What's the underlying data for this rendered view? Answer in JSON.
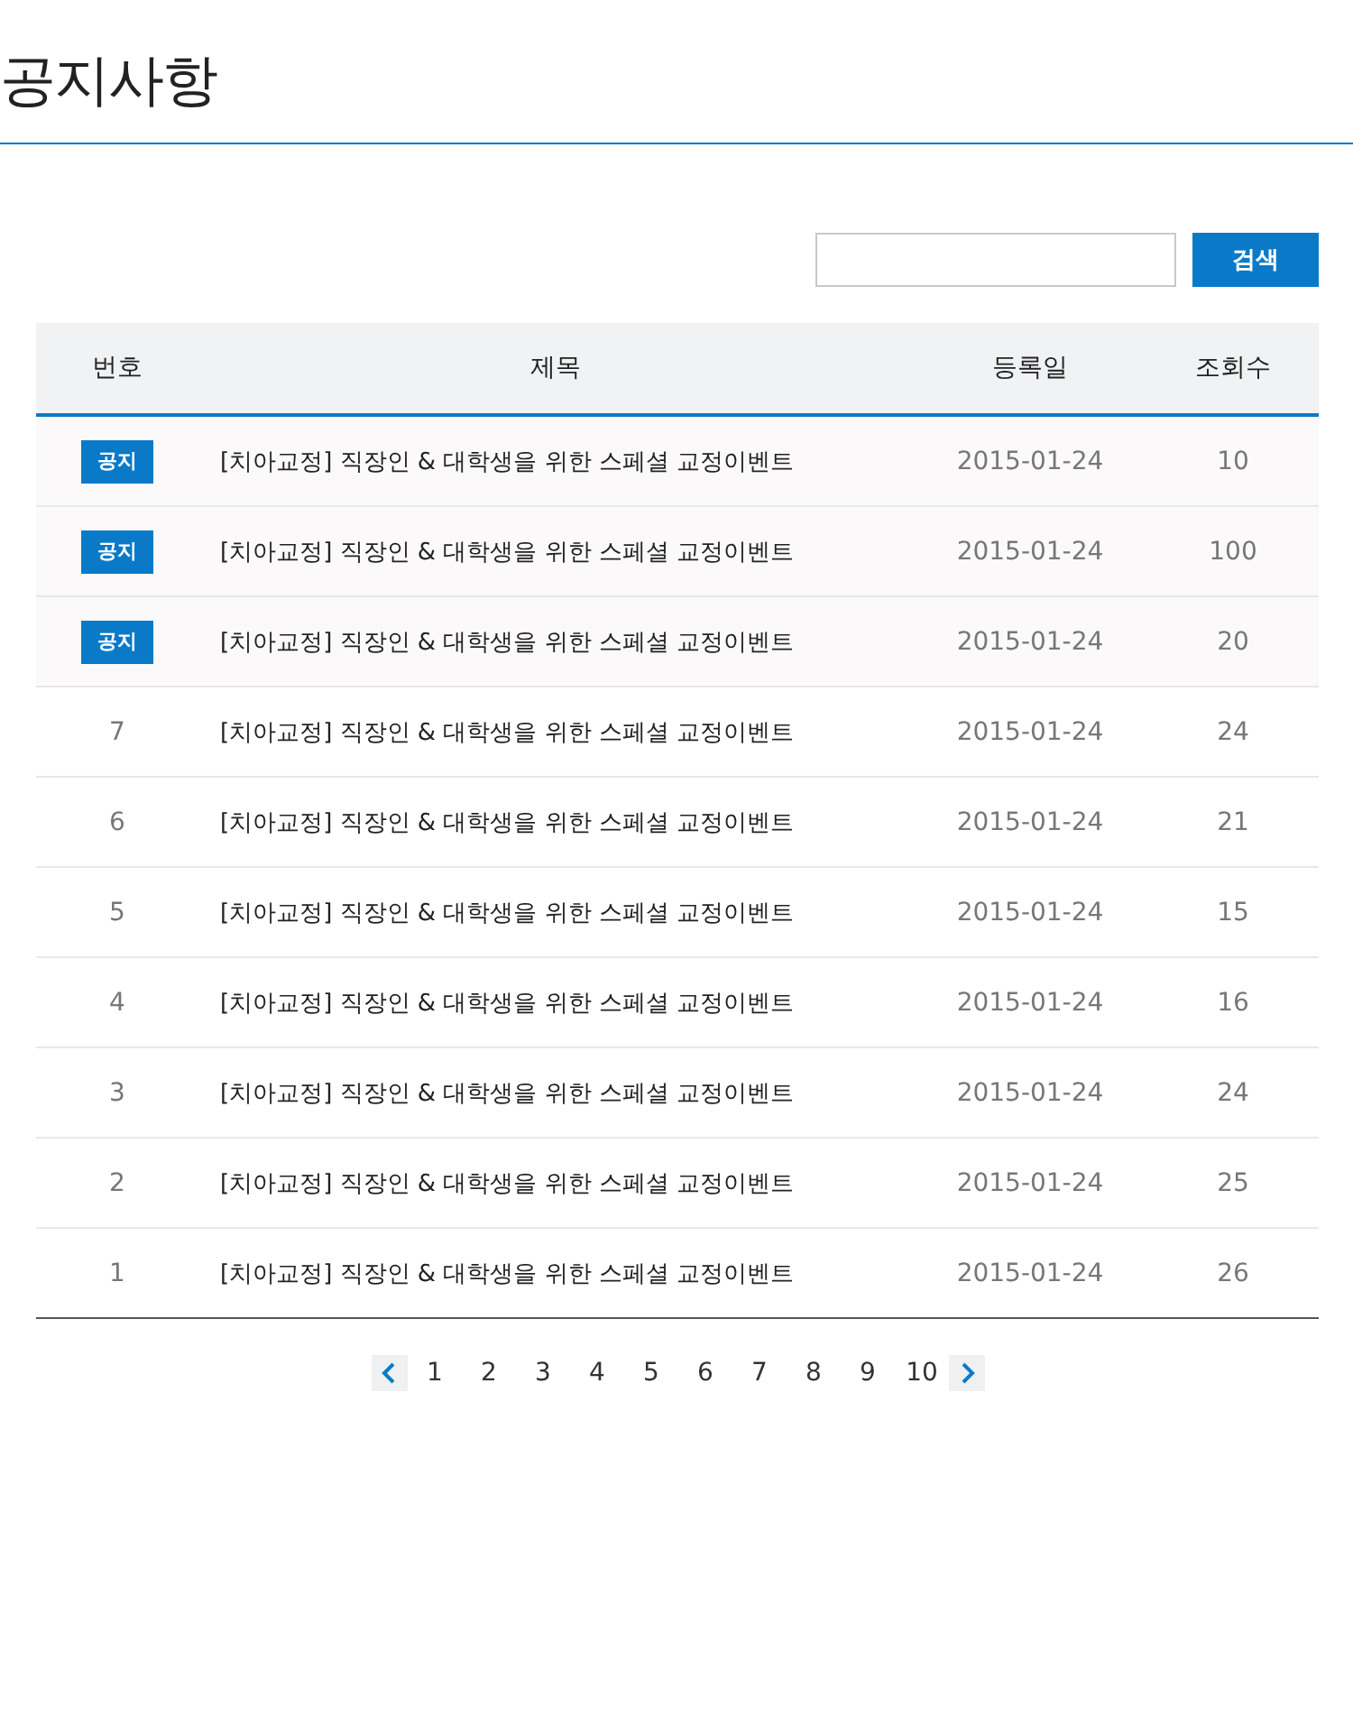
{
  "page_title": "공지사항",
  "search": {
    "button": "검색"
  },
  "table": {
    "columns": [
      "번호",
      "제목",
      "등록일",
      "조회수"
    ],
    "rows": [
      {
        "kind": "notice",
        "number": "공지",
        "title": "[치아교정] 직장인 & 대학생을 위한 스페셜 교정이벤트",
        "date": "2015-01-24",
        "views": "10"
      },
      {
        "kind": "notice",
        "number": "공지",
        "title": "[치아교정] 직장인 & 대학생을 위한 스페셜 교정이벤트",
        "date": "2015-01-24",
        "views": "100"
      },
      {
        "kind": "notice",
        "number": "공지",
        "title": "[치아교정] 직장인 & 대학생을 위한 스페셜 교정이벤트",
        "date": "2015-01-24",
        "views": "20"
      },
      {
        "kind": "post",
        "number": "7",
        "title": "[치아교정] 직장인 & 대학생을 위한 스페셜 교정이벤트",
        "date": "2015-01-24",
        "views": "24"
      },
      {
        "kind": "post",
        "number": "6",
        "title": "[치아교정] 직장인 & 대학생을 위한 스페셜 교정이벤트",
        "date": "2015-01-24",
        "views": "21"
      },
      {
        "kind": "post",
        "number": "5",
        "title": "[치아교정] 직장인 & 대학생을 위한 스페셜 교정이벤트",
        "date": "2015-01-24",
        "views": "15"
      },
      {
        "kind": "post",
        "number": "4",
        "title": "[치아교정] 직장인 & 대학생을 위한 스페셜 교정이벤트",
        "date": "2015-01-24",
        "views": "16"
      },
      {
        "kind": "post",
        "number": "3",
        "title": "[치아교정] 직장인 & 대학생을 위한 스페셜 교정이벤트",
        "date": "2015-01-24",
        "views": "24"
      },
      {
        "kind": "post",
        "number": "2",
        "title": "[치아교정] 직장인 & 대학생을 위한 스페셜 교정이벤트",
        "date": "2015-01-24",
        "views": "25"
      },
      {
        "kind": "post",
        "number": "1",
        "title": "[치아교정] 직장인 & 대학생을 위한 스페셜 교정이벤트",
        "date": "2015-01-24",
        "views": "26"
      }
    ]
  },
  "pagination": {
    "pages": [
      "1",
      "2",
      "3",
      "4",
      "5",
      "6",
      "7",
      "8",
      "9",
      "10"
    ]
  }
}
